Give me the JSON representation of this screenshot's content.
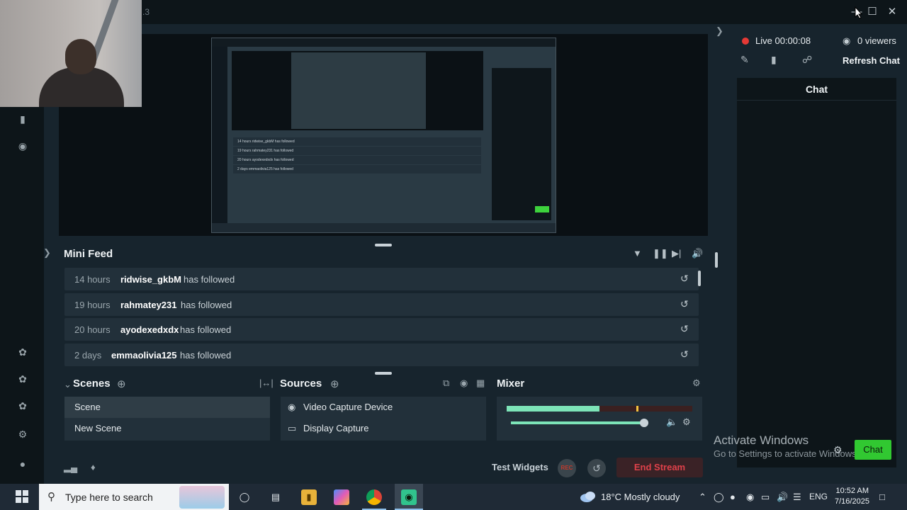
{
  "titlebar": {
    "version_fragment": ".3"
  },
  "preview": {
    "feed": [
      {
        "text": "14 hours  ridwise_gkbM  has followed"
      },
      {
        "text": "19 hours  rahmatey231  has followed"
      },
      {
        "text": "20 hours  ayodexedxdx  has followed"
      },
      {
        "text": "2 days  emmaolivia125  has followed"
      }
    ]
  },
  "mini_feed": {
    "title": "Mini Feed",
    "items": [
      {
        "time": "14 hours",
        "user": "ridwise_gkbM",
        "action": "has followed"
      },
      {
        "time": "19 hours",
        "user": "rahmatey231",
        "action": "has followed"
      },
      {
        "time": "20 hours",
        "user": "ayodexedxdx",
        "action": "has followed"
      },
      {
        "time": "2 days",
        "user": "emmaolivia125",
        "action": "has followed"
      }
    ]
  },
  "scenes": {
    "title": "Scenes",
    "items": [
      {
        "label": "Scene",
        "selected": true
      },
      {
        "label": "New Scene",
        "selected": false
      }
    ]
  },
  "sources": {
    "title": "Sources",
    "items": [
      {
        "label": "Video Capture Device",
        "icon": "webcam-icon"
      },
      {
        "label": "Display Capture",
        "icon": "monitor-icon"
      }
    ]
  },
  "mixer": {
    "title": "Mixer",
    "meter_level": 0.5,
    "volume_level": 0.97
  },
  "bottom_bar": {
    "test_widgets": "Test Widgets",
    "rec": "REC",
    "end_stream": "End Stream"
  },
  "live": {
    "status": "Live 00:00:08",
    "viewers": "0 viewers",
    "refresh_chat": "Refresh Chat"
  },
  "chat": {
    "header": "Chat",
    "button": "Chat"
  },
  "watermark": {
    "line1": "Activate Windows",
    "line2": "Go to Settings to activate Windows."
  },
  "taskbar": {
    "search_placeholder": "Type here to search",
    "weather": "18°C  Mostly cloudy",
    "language": "ENG",
    "time": "10:52 AM",
    "date": "7/16/2025"
  },
  "colors": {
    "accent_green": "#31c831",
    "live_red": "#e53935",
    "end_stream_red": "#e0414a",
    "panel_bg": "#17242d"
  }
}
